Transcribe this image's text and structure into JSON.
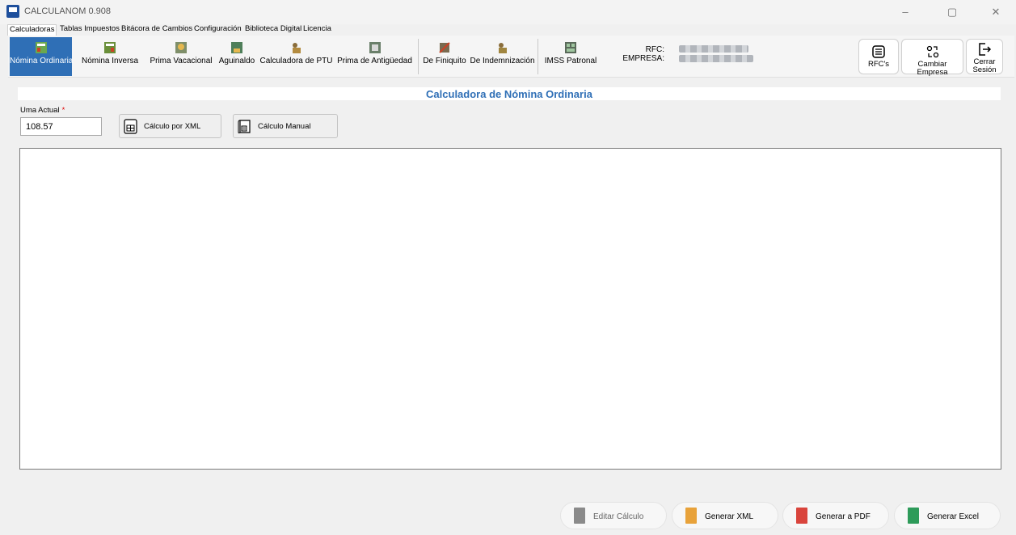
{
  "window": {
    "title": "CALCULANOM 0.908",
    "controls": [
      "–",
      "▢",
      "✕"
    ]
  },
  "menu_tabs": [
    "Calculadoras",
    "Tablas Impuestos",
    "Bitácora de Cambios",
    "Configuración",
    "Biblioteca Digital",
    "Licencia"
  ],
  "active_menu_tab": "Calculadoras",
  "ribbon": {
    "calculators": [
      {
        "label": "Nómina Ordinaria",
        "icon": "payroll-icon",
        "active": true
      },
      {
        "label": "Nómina Inversa",
        "icon": "reverse-payroll-icon"
      },
      {
        "label": "Prima Vacacional",
        "icon": "vacation-bonus-icon"
      },
      {
        "label": "Aguinaldo",
        "icon": "christmas-bonus-icon"
      },
      {
        "label": "Calculadora de PTU",
        "icon": "profit-sharing-icon"
      },
      {
        "label": "Prima de Antigüedad",
        "icon": "seniority-bonus-icon"
      },
      {
        "label": "De Finiquito",
        "icon": "settlement-icon"
      },
      {
        "label": "De Indemnización",
        "icon": "compensation-icon"
      },
      {
        "label": "IMSS Patronal",
        "icon": "imss-icon"
      }
    ],
    "rfc_label": "RFC:",
    "empresa_label": "EMPRESA:",
    "actions": [
      {
        "label": "RFC's",
        "icon": "list-icon"
      },
      {
        "label": "Cambiar Empresa",
        "icon": "switch-company-icon"
      },
      {
        "label": "Cerrar Sesión",
        "icon": "logout-icon"
      }
    ]
  },
  "main": {
    "title": "Calculadora de Nómina Ordinaria",
    "uma_label": "Uma Actual",
    "uma_required_mark": "*",
    "uma_value": "108.57",
    "calc_xml_label": "Cálculo por XML",
    "calc_manual_label": "Cálculo Manual"
  },
  "footer_actions": [
    {
      "label": "Editar Cálculo",
      "enabled": false,
      "color": "#8a8a8a"
    },
    {
      "label": "Generar XML",
      "enabled": true,
      "color": "#e8a23a"
    },
    {
      "label": "Generar a PDF",
      "enabled": true,
      "color": "#d9443c"
    },
    {
      "label": "Generar Excel",
      "enabled": true,
      "color": "#2e9b5a"
    }
  ],
  "colors": {
    "accent": "#2f6fb6",
    "required": "#d00000"
  }
}
